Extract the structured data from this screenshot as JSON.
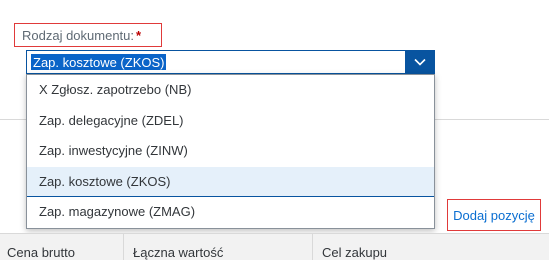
{
  "field": {
    "label": "Rodzaj dokumentu:",
    "required_mark": "*",
    "selected_value": "Zap. kosztowe (ZKOS)"
  },
  "dropdown": {
    "items": [
      {
        "label": "X Zgłosz. zapotrzebo (NB)"
      },
      {
        "label": "Zap. delegacyjne (ZDEL)"
      },
      {
        "label": "Zap. inwestycyjne (ZINW)"
      },
      {
        "label": "Zap. kosztowe (ZKOS)",
        "selected": true
      },
      {
        "label": "Zap. magazynowe (ZMAG)"
      }
    ]
  },
  "actions": {
    "add_item_label": "Dodaj pozycję"
  },
  "table": {
    "columns": [
      "Cena brutto",
      "Łączna wartość",
      "Cel zakupu"
    ]
  },
  "colors": {
    "accent": "#0854a0",
    "selection_highlight": "#0a64c8",
    "link": "#0a6ed1",
    "required": "#bb0000",
    "annotation_border": "#e03a3a"
  },
  "icons": {
    "select_arrow": "chevron-down-icon"
  }
}
